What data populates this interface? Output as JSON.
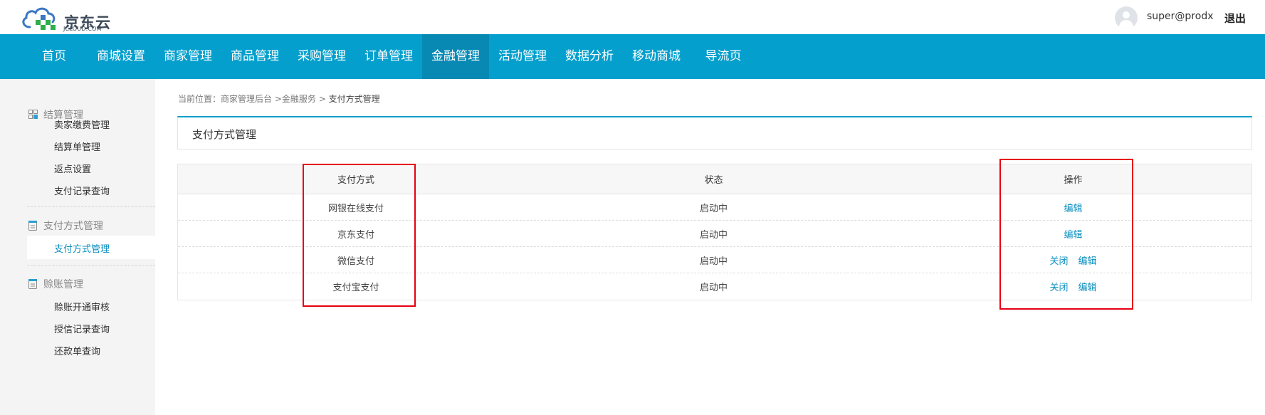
{
  "header": {
    "logo_cn": "京东云",
    "logo_en": "JCLOUD.COM",
    "username": "super@prodx",
    "logout_label": "退出"
  },
  "nav": {
    "items": [
      {
        "label": "首页"
      },
      {
        "label": "商城设置"
      },
      {
        "label": "商家管理"
      },
      {
        "label": "商品管理"
      },
      {
        "label": "采购管理"
      },
      {
        "label": "订单管理"
      },
      {
        "label": "金融管理",
        "active": true
      },
      {
        "label": "活动管理"
      },
      {
        "label": "数据分析"
      },
      {
        "label": "移动商城"
      },
      {
        "label": "导流页"
      }
    ]
  },
  "sidebar": {
    "sections": [
      {
        "title": "结算管理",
        "icon": "grid-icon",
        "links": [
          "卖家缴费管理",
          "结算单管理",
          "返点设置",
          "支付记录查询"
        ]
      },
      {
        "title": "支付方式管理",
        "icon": "document-icon",
        "links": [
          "支付方式管理"
        ]
      },
      {
        "title": "赊账管理",
        "icon": "document-icon",
        "links": [
          "赊账开通审核",
          "授信记录查询",
          "还款单查询"
        ]
      }
    ],
    "active_link": "支付方式管理"
  },
  "breadcrumb": {
    "prefix": "当前位置：",
    "items": [
      "商家管理后台",
      "金融服务",
      "支付方式管理"
    ],
    "sep1": ">",
    "sep2": ">"
  },
  "panel": {
    "title": "支付方式管理"
  },
  "table": {
    "columns": [
      "支付方式",
      "状态",
      "操作"
    ],
    "rows": [
      {
        "method": "网银在线支付",
        "status": "启动中",
        "actions": [
          "编辑"
        ]
      },
      {
        "method": "京东支付",
        "status": "启动中",
        "actions": [
          "编辑"
        ]
      },
      {
        "method": "微信支付",
        "status": "启动中",
        "actions": [
          "关闭",
          "编辑"
        ]
      },
      {
        "method": "支付宝支付",
        "status": "启动中",
        "actions": [
          "关闭",
          "编辑"
        ]
      }
    ]
  },
  "colors": {
    "nav_bg": "#049fcd",
    "nav_active": "#0789b4",
    "link": "#0a8fbf",
    "highlight_box": "#e60012"
  }
}
